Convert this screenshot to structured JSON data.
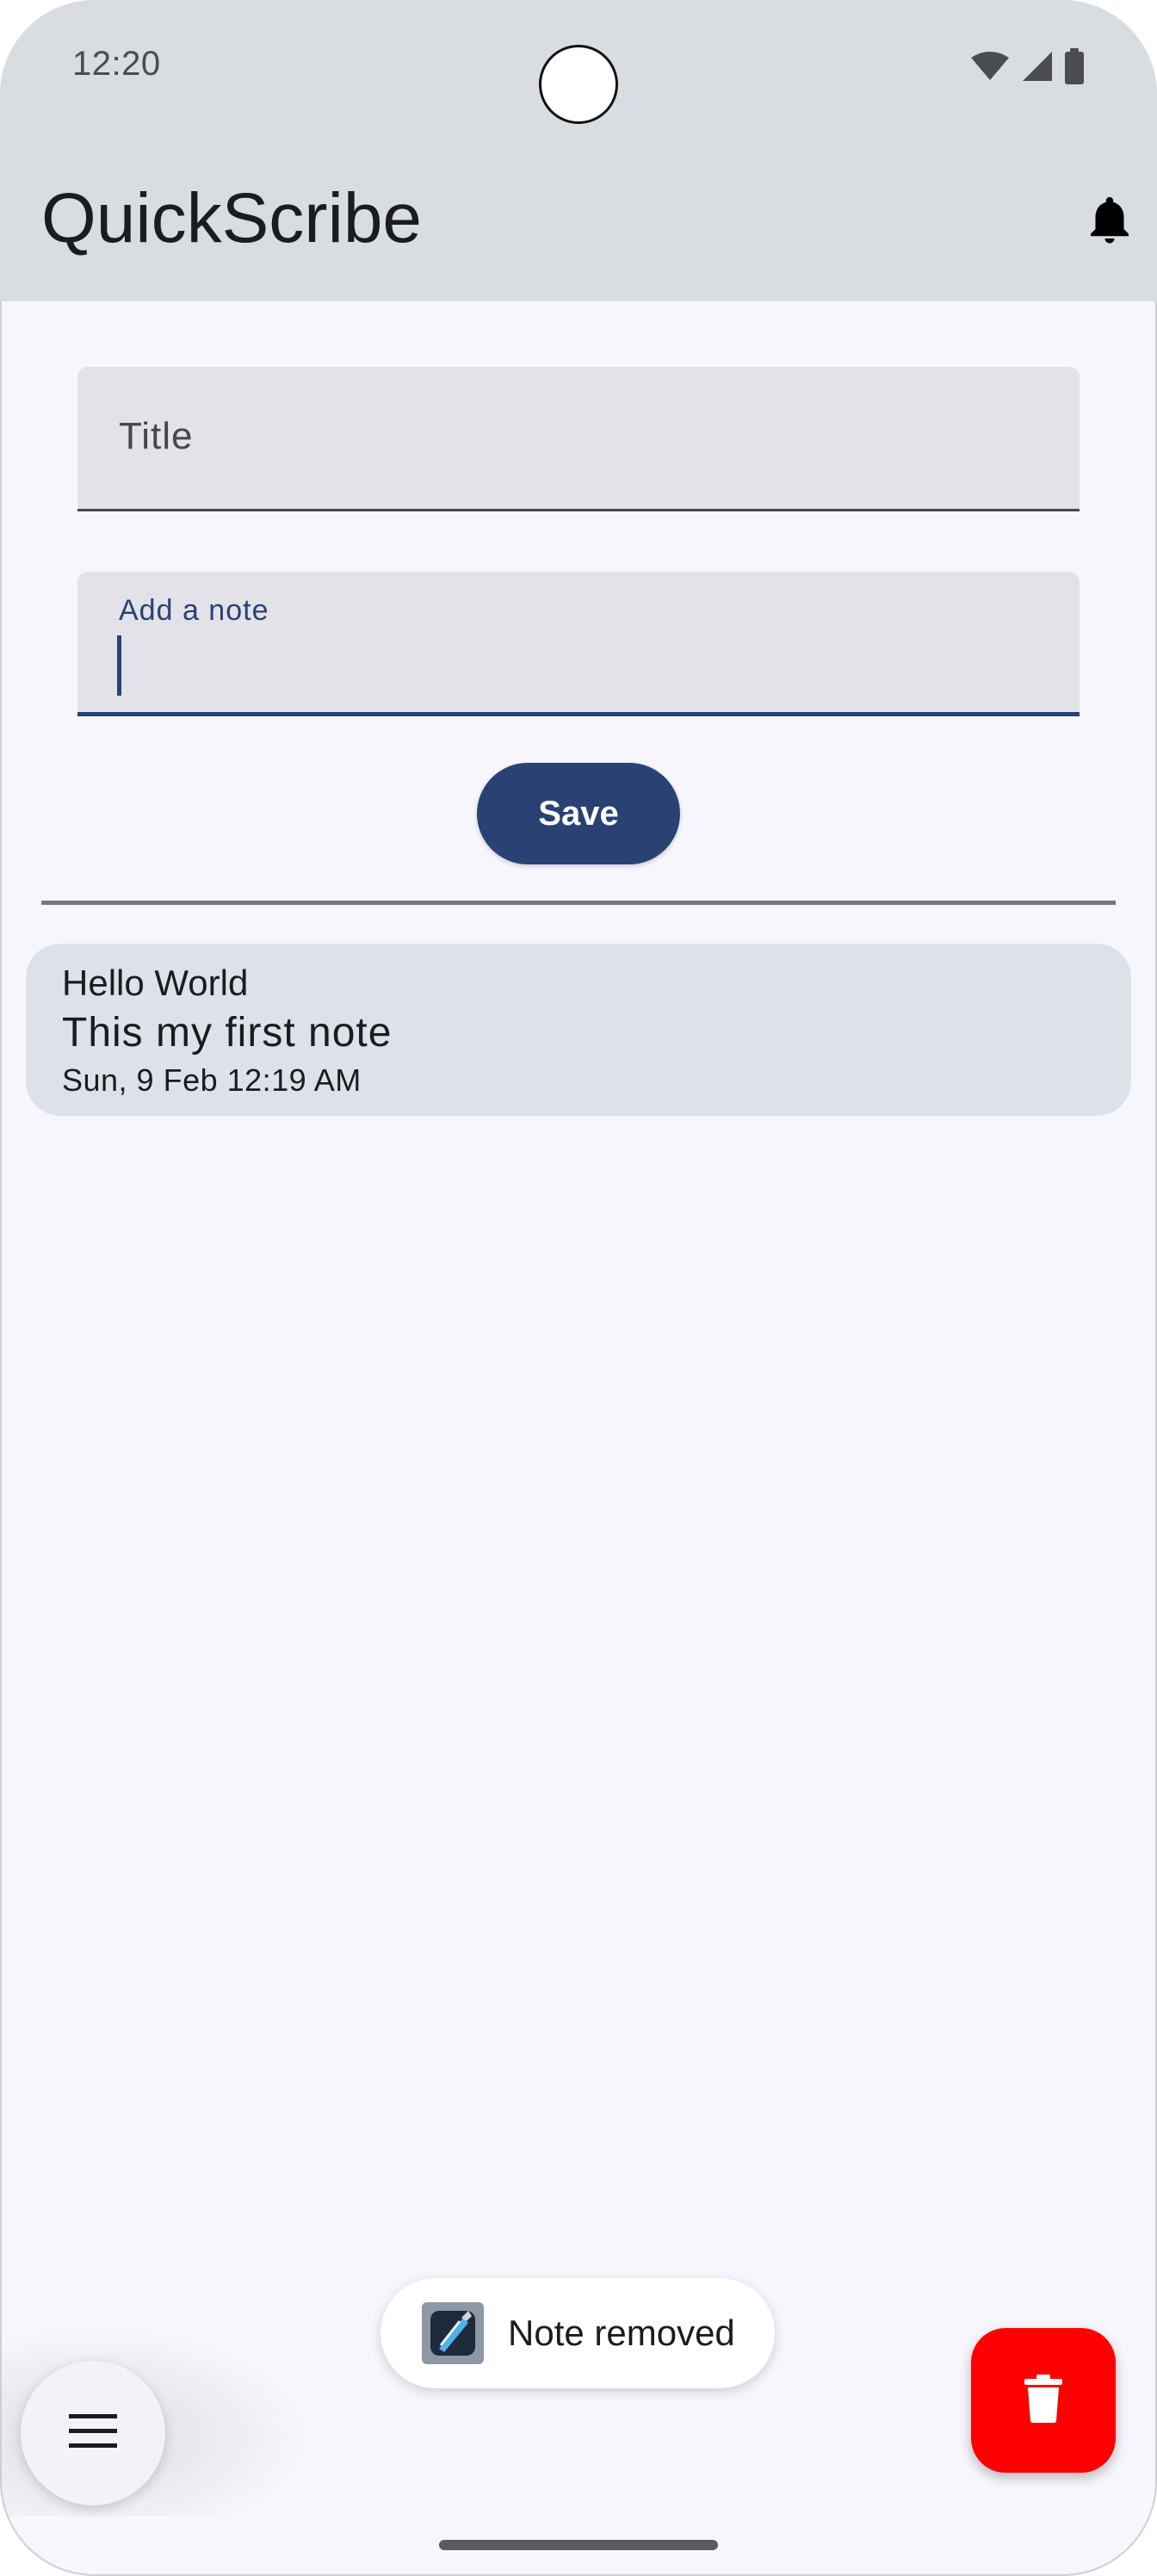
{
  "status_bar": {
    "time": "12:20",
    "icons": [
      "wifi-icon",
      "cellular-signal-icon",
      "battery-icon"
    ]
  },
  "app_bar": {
    "title": "QuickScribe",
    "action_icon": "bell-icon"
  },
  "form": {
    "title_placeholder": "Title",
    "note_label": "Add a note",
    "note_value": "",
    "save_label": "Save"
  },
  "notes": [
    {
      "title": "Hello World",
      "body": "This my first note",
      "date": "Sun, 9 Feb 12:19 AM"
    }
  ],
  "toast": {
    "message": "Note removed",
    "icon": "app-icon"
  },
  "fabs": {
    "menu_icon": "menu-icon",
    "delete_icon": "trash-icon"
  },
  "colors": {
    "primary": "#2a4174",
    "top_bar": "#d9dce0",
    "background": "#f7f6fc",
    "note_card": "#dde2e9",
    "delete_fab": "#ff0000"
  }
}
